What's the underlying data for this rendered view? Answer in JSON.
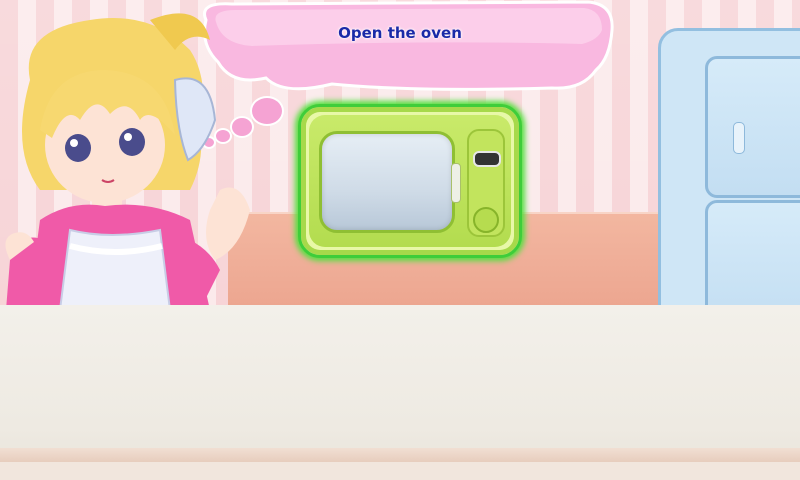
{
  "instruction": {
    "text": "Open the oven"
  },
  "icons": {
    "bubble": "speech-bubble-icon",
    "character": "chef-girl-character",
    "microwave": "microwave-icon",
    "fridge": "fridge-icon"
  },
  "colors": {
    "bubble": "#f9b8e0",
    "text": "#1a2aa8",
    "highlight": "#55e03f",
    "microwave": "#c9ea6a",
    "fridge": "#cfe6f6"
  }
}
